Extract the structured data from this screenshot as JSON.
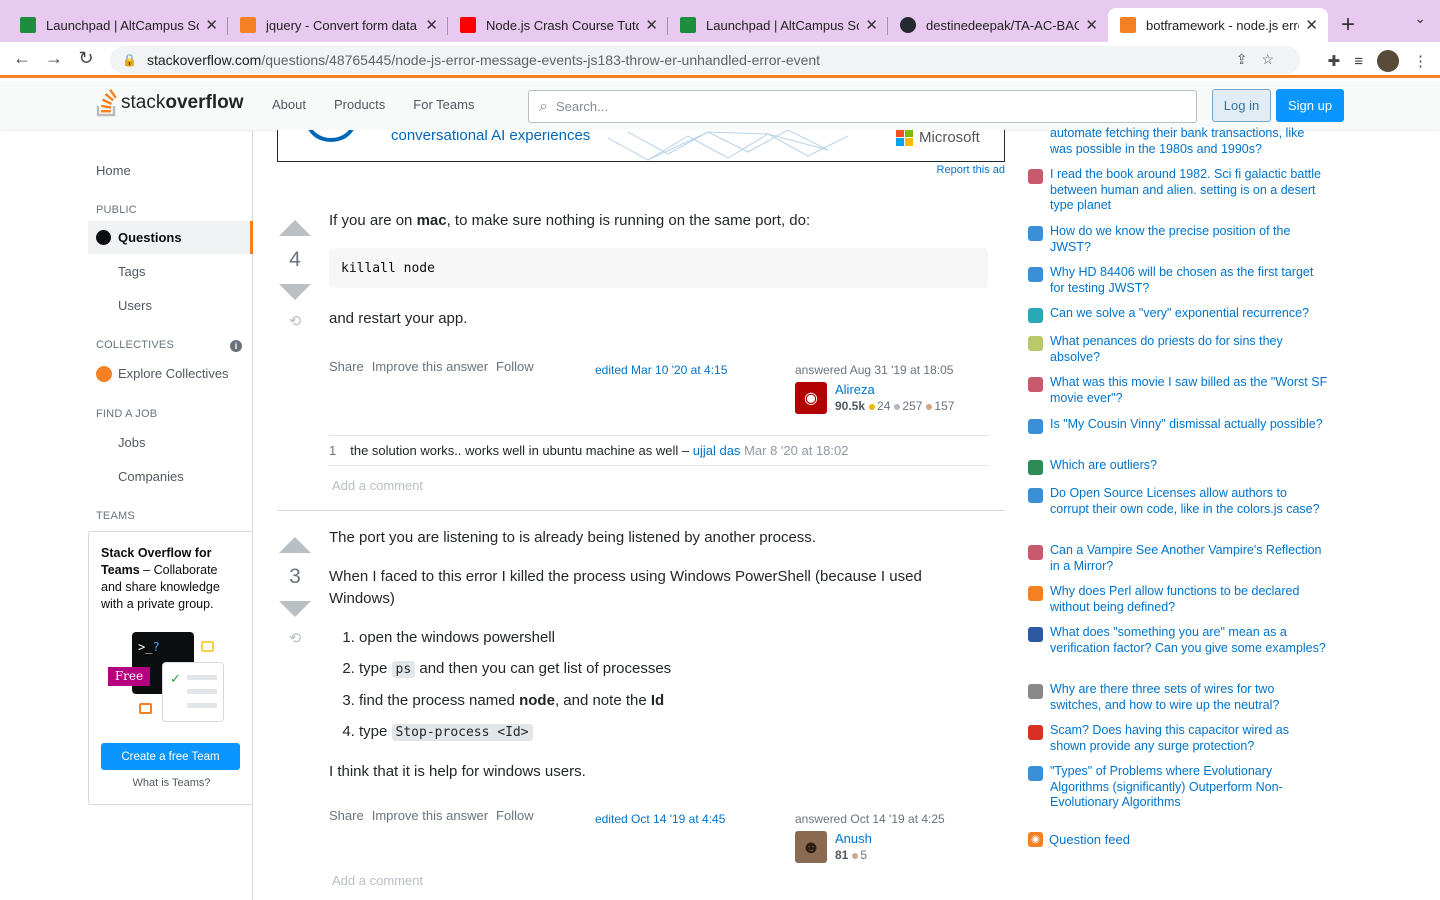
{
  "browser": {
    "tabs": [
      {
        "title": "Launchpad | AltCampus Sc",
        "color": "#1e8e3e"
      },
      {
        "title": "jquery - Convert form data",
        "color": "#f48024"
      },
      {
        "title": "Node.js Crash Course Tutor",
        "color": "#ff0000"
      },
      {
        "title": "Launchpad | AltCampus Sc",
        "color": "#1e8e3e"
      },
      {
        "title": "destinedeepak/TA-AC-BAC",
        "color": "#24292f"
      },
      {
        "title": "botframework - node.js erro",
        "color": "#f48024"
      }
    ],
    "url_host": "stackoverflow.com",
    "url_path": "/questions/48765445/node-js-error-message-events-js183-throw-er-unhandled-error-event"
  },
  "header": {
    "logo_a": "stack",
    "logo_b": "overflow",
    "nav": [
      "About",
      "Products",
      "For Teams"
    ],
    "search_placeholder": "Search...",
    "login": "Log in",
    "signup": "Sign up"
  },
  "leftnav": {
    "home": "Home",
    "public": "PUBLIC",
    "questions": "Questions",
    "tags": "Tags",
    "users": "Users",
    "collectives": "COLLECTIVES",
    "explore": "Explore Collectives",
    "find_job": "FIND A JOB",
    "jobs": "Jobs",
    "companies": "Companies",
    "teams": "TEAMS",
    "teams_title": "Stack Overflow for Teams",
    "teams_desc": " – Collaborate and share knowledge with a private group.",
    "free": "Free",
    "create_team": "Create a free Team",
    "what_teams": "What is Teams?"
  },
  "ad": {
    "text": "conversational AI experiences",
    "brand": "Microsoft",
    "report": "Report this ad"
  },
  "answer1": {
    "votes": "4",
    "p1_a": "If you are on ",
    "p1_b": "mac",
    "p1_c": ", to make sure nothing is running on the same port, do:",
    "code": "killall node",
    "p2": "and restart your app.",
    "share": "Share",
    "improve": "Improve this answer",
    "follow": "Follow",
    "edited": "edited Mar 10 '20 at 4:15",
    "answered": "answered Aug 31 '19 at 18:05",
    "user": "Alireza",
    "rep": "90.5k",
    "gold": "24",
    "silver": "257",
    "bronze": "157",
    "comment_score": "1",
    "comment_text": "the solution works.. works well in ubuntu machine as well – ",
    "comment_user": "ujjal das",
    "comment_date": "Mar 8 '20 at 18:02",
    "add_comment": "Add a comment"
  },
  "answer2": {
    "votes": "3",
    "p1": "The port you are listening to is already being listened by another process.",
    "p2": "When I faced to this error I killed the process using Windows PowerShell (because I used Windows)",
    "li1": "open the windows powershell",
    "li2_a": "type ",
    "li2_code": "ps",
    "li2_b": " and then you can get list of processes",
    "li3_a": "find the process named ",
    "li3_b": "node",
    "li3_c": ", and note the ",
    "li3_d": "Id",
    "li4_a": "type ",
    "li4_code": "Stop-process <Id>",
    "p3": "I think that it is help for windows users.",
    "share": "Share",
    "improve": "Improve this answer",
    "follow": "Follow",
    "edited": "edited Oct 14 '19 at 4:45",
    "answered": "answered Oct 14 '19 at 4:25",
    "user": "Anush",
    "rep": "81",
    "bronze": "5",
    "add_comment": "Add a comment"
  },
  "hot_questions": [
    {
      "title": "automate fetching their bank transactions, like was possible in the 1980s and 1990s?",
      "color": "#ffffff"
    },
    {
      "title": "I read the book around 1982. Sci fi galactic battle between human and alien. setting is on a desert type planet",
      "color": "#c8586b"
    },
    {
      "title": "How do we know the precise position of the JWST?",
      "color": "#3b8fd6"
    },
    {
      "title": "Why HD 84406 will be chosen as the first target for testing JWST?",
      "color": "#3b8fd6"
    },
    {
      "title": "Can we solve a \"very\" exponential recurrence?",
      "color": "#2aa8b8"
    },
    {
      "title": "What penances do priests do for sins they absolve?",
      "color": "#b8c96a"
    },
    {
      "title": "What was this movie I saw billed as the \"Worst SF movie ever\"?",
      "color": "#c8586b"
    },
    {
      "title": "Is \"My Cousin Vinny\" dismissal actually possible?",
      "color": "#3b8fd6"
    },
    {
      "title": "Which are outliers?",
      "color": "#2e8b57"
    },
    {
      "title": "Do Open Source Licenses allow authors to corrupt their own code, like in the colors.js case?",
      "color": "#3b8fd6"
    },
    {
      "title": "Can a Vampire See Another Vampire's Reflection in a Mirror?",
      "color": "#c8586b"
    },
    {
      "title": "Why does Perl allow functions to be declared without being defined?",
      "color": "#f48024"
    },
    {
      "title": "What does \"something you are\" mean as a verification factor? Can you give some examples?",
      "color": "#2c5aa0"
    },
    {
      "title": "Why are there three sets of wires for two switches, and how to wire up the neutral?",
      "color": "#888888"
    },
    {
      "title": "Scam? Does having this capacitor wired as shown provide any surge protection?",
      "color": "#d93025"
    },
    {
      "title": "\"Types\" of Problems where Evolutionary Algorithms (significantly) Outperform Non-Evolutionary Algorithms",
      "color": "#3b8fd6"
    }
  ],
  "question_feed": "Question feed"
}
